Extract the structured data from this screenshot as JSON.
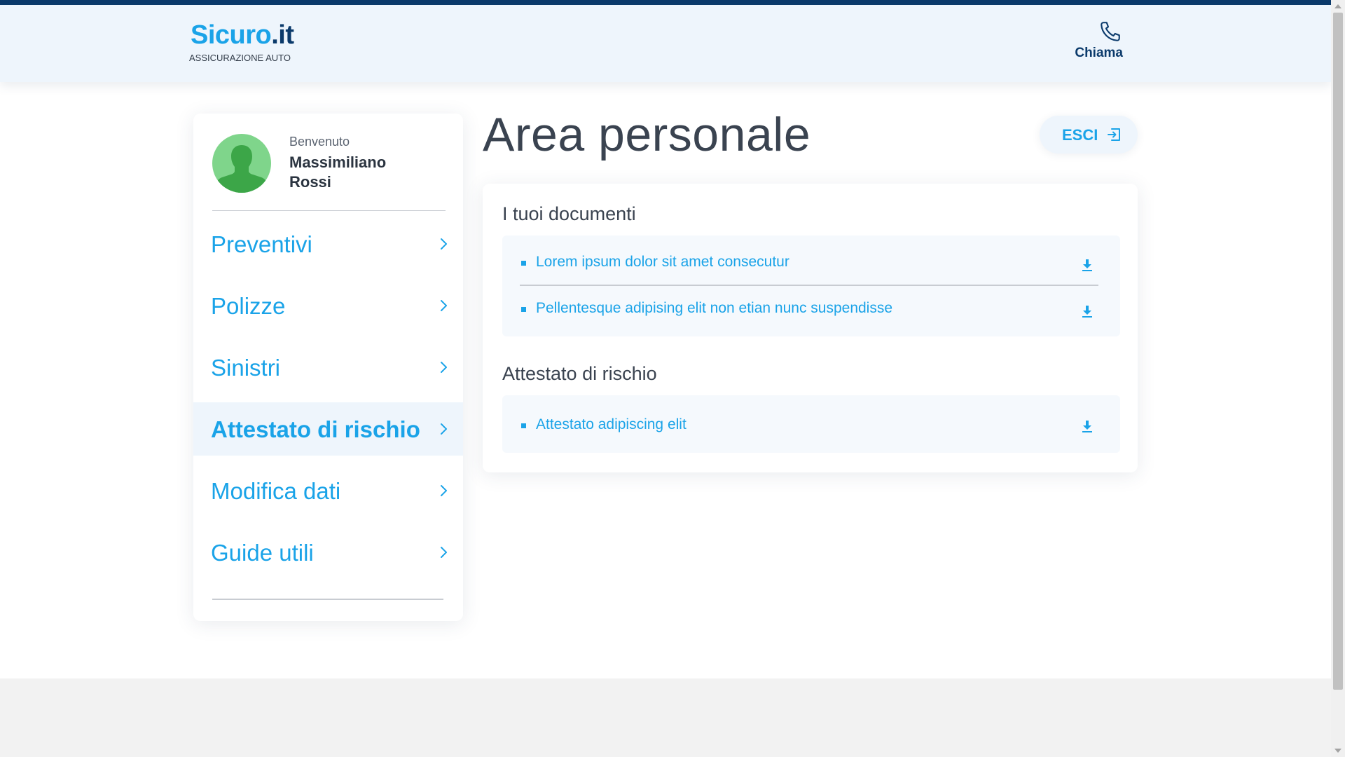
{
  "header": {
    "logo_brand": "Sicuro",
    "logo_tld": ".it",
    "logo_subtitle": "ASSICURAZIONE AUTO",
    "call_label": "Chiama"
  },
  "user": {
    "welcome": "Benvenuto",
    "name": "Massimiliano Rossi"
  },
  "nav": {
    "items": [
      {
        "label": "Preventivi",
        "active": false
      },
      {
        "label": "Polizze",
        "active": false
      },
      {
        "label": "Sinistri",
        "active": false
      },
      {
        "label": "Attestato di rischio",
        "active": true
      },
      {
        "label": "Modifica dati",
        "active": false
      },
      {
        "label": "Guide utili",
        "active": false
      }
    ]
  },
  "main": {
    "title": "Area personale",
    "logout_label": "ESCI",
    "documents_title": "I tuoi documenti",
    "documents": [
      "Lorem ipsum dolor sit amet consecutur",
      "Pellentesque adipising elit non etian nunc suspendisse"
    ],
    "risk_title": "Attestato di rischio",
    "risk_documents": [
      "Attestato adipiscing elit"
    ]
  },
  "colors": {
    "brand_blue": "#1aa3e8",
    "navy": "#0b3a6b",
    "avatar_green": "#7fd58b",
    "avatar_dark_green": "#3ca648"
  },
  "icons": {
    "call": "phone-icon",
    "logout": "exit-icon",
    "nav_arrow": "chevron-right-icon",
    "download": "download-icon",
    "avatar": "user-silhouette-icon"
  }
}
